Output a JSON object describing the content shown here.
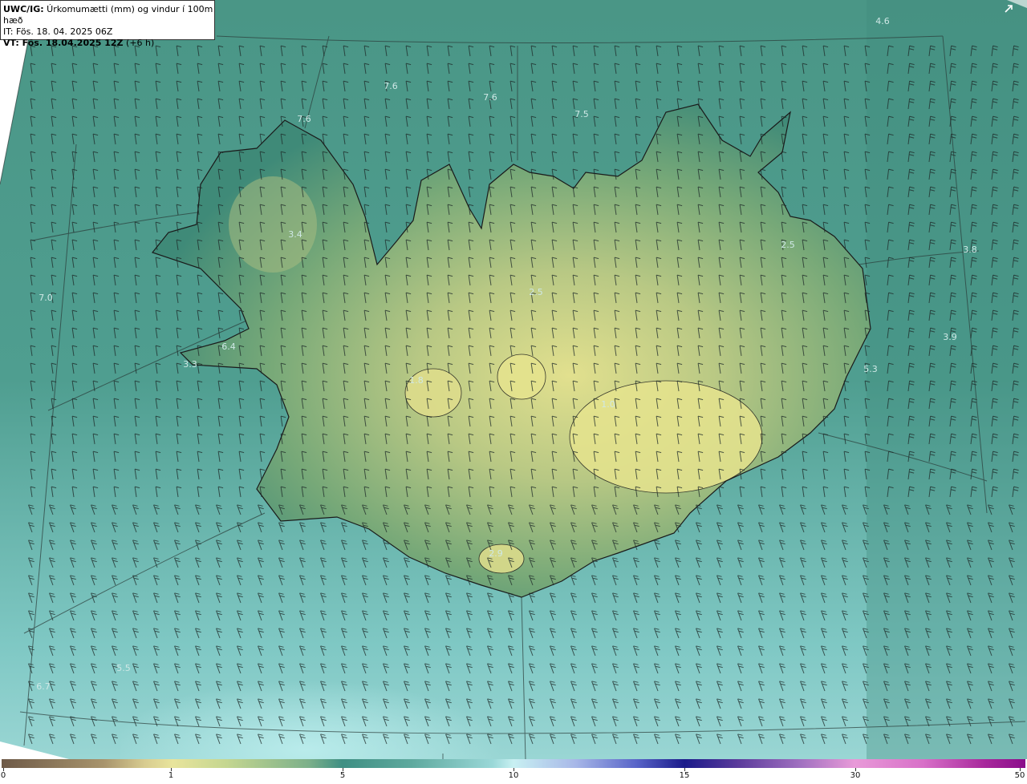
{
  "header": {
    "title_bold": "UWC/IG:",
    "title_rest": " Úrkomumætti (mm) og vindur í 100m hæð",
    "init_line": "IT: Fös. 18. 04. 2025 06Z",
    "valid_bold": "VT: Fös. 18.04.2025 12Z",
    "valid_rest": " (+6 h)"
  },
  "map_labels": [
    {
      "text": "4.6"
    },
    {
      "text": "7.6"
    },
    {
      "text": "7.6"
    },
    {
      "text": "7.5"
    },
    {
      "text": "7.6"
    },
    {
      "text": "3.4"
    },
    {
      "text": "2.5"
    },
    {
      "text": "2.5"
    },
    {
      "text": "3.8"
    },
    {
      "text": "7.0"
    },
    {
      "text": "6.4"
    },
    {
      "text": "3.3"
    },
    {
      "text": "3.9"
    },
    {
      "text": "5.3"
    },
    {
      "text": "1.8"
    },
    {
      "text": "1.0"
    },
    {
      "text": "2.9"
    },
    {
      "text": "5.5"
    },
    {
      "text": "6.7"
    }
  ],
  "colorbar": {
    "ticks": [
      {
        "label": "0",
        "value": 0
      },
      {
        "label": "1",
        "value": 1
      },
      {
        "label": "5",
        "value": 5
      },
      {
        "label": "10",
        "value": 10
      },
      {
        "label": "15",
        "value": 15
      },
      {
        "label": "30",
        "value": 30
      },
      {
        "label": "50",
        "value": 50
      }
    ]
  },
  "colors": {
    "sea": "#4f9e90",
    "land_low": "#3e8a7a",
    "land_high": "#d6d88a",
    "coast": "#1a1a1a"
  },
  "icons": {
    "expand": "expand-arrow-icon"
  }
}
